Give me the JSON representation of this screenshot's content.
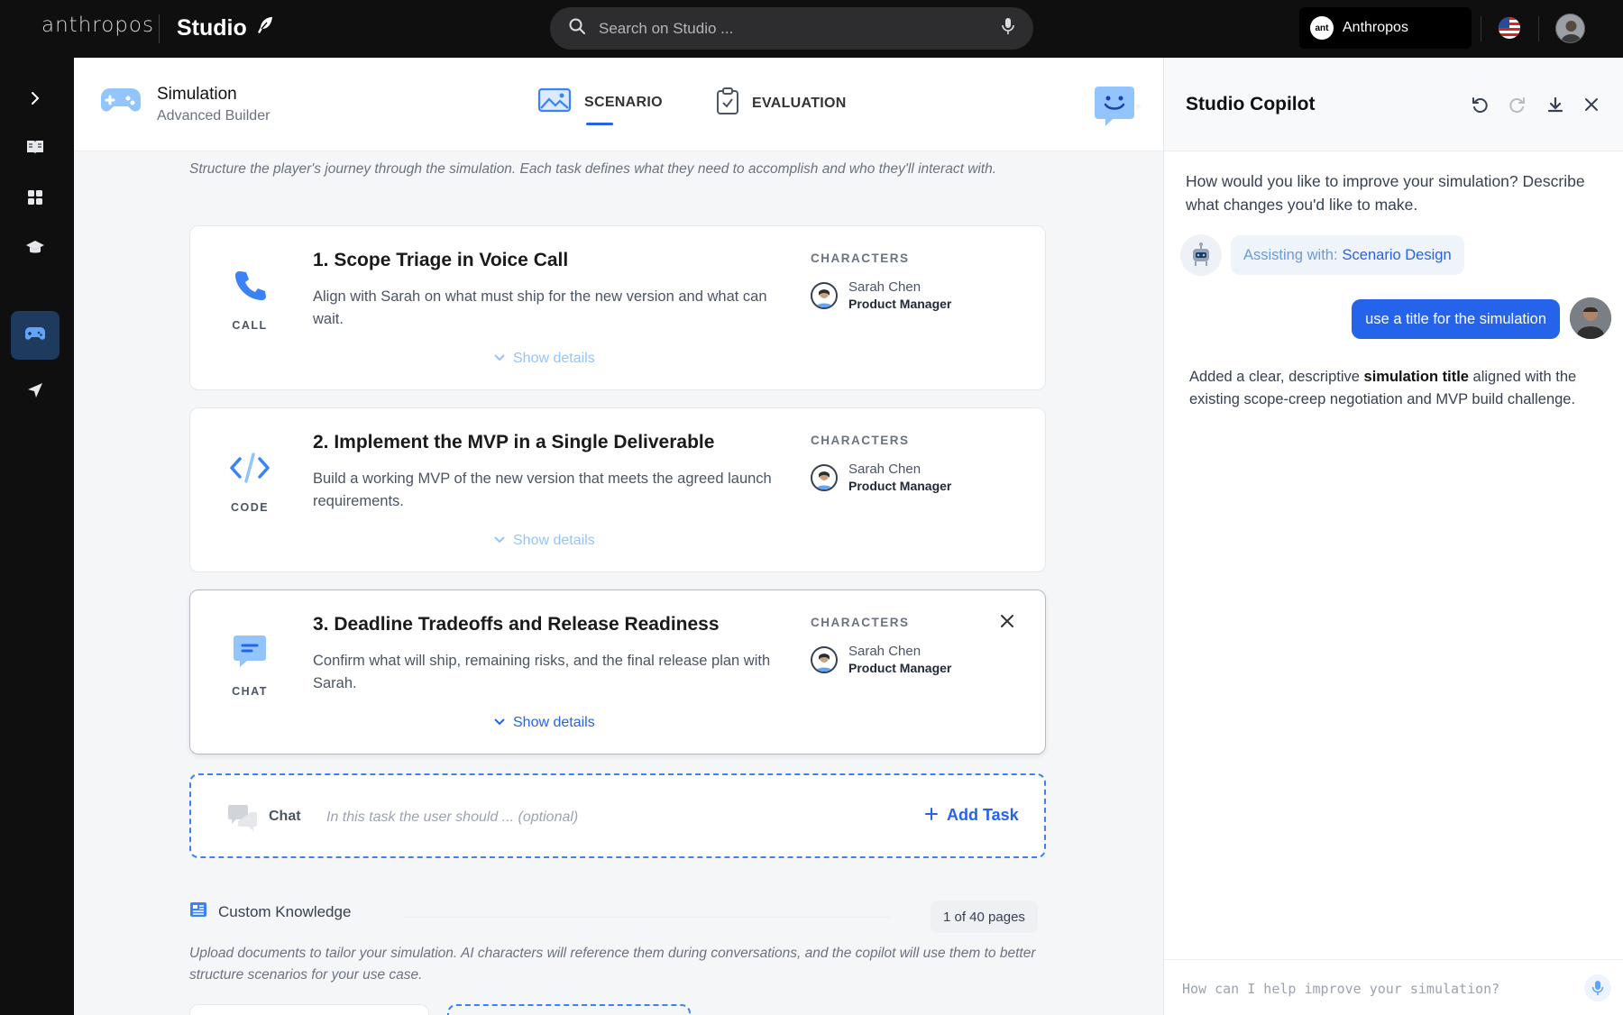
{
  "topbar": {
    "logo": "anthropos",
    "studio": "Studio",
    "search_placeholder": "Search on Studio ...",
    "org_name": "Anthropos",
    "org_badge": "ant"
  },
  "builder": {
    "title": "Simulation",
    "subtitle": "Advanced Builder",
    "tabs": [
      {
        "label": "SCENARIO",
        "active": true
      },
      {
        "label": "EVALUATION",
        "active": false
      }
    ]
  },
  "main": {
    "intro": "Structure the player's journey through the simulation. Each task defines what they need to accomplish and who they'll interact with.",
    "tasks": [
      {
        "type": "CALL",
        "title": "1. Scope Triage in Voice Call",
        "description": "Align with Sarah on what must ship for the new version and what can wait.",
        "show_details": "Show details",
        "characters_label": "CHARACTERS",
        "character_name": "Sarah Chen",
        "character_role": "Product Manager"
      },
      {
        "type": "CODE",
        "title": "2. Implement the MVP in a Single Deliverable",
        "description": "Build a working MVP of the new version that meets the agreed launch requirements.",
        "show_details": "Show details",
        "characters_label": "CHARACTERS",
        "character_name": "Sarah Chen",
        "character_role": "Product Manager"
      },
      {
        "type": "CHAT",
        "title": "3. Deadline Tradeoffs and Release Readiness",
        "description": "Confirm what will ship, remaining risks, and the final release plan with Sarah.",
        "show_details": "Show details",
        "characters_label": "CHARACTERS",
        "character_name": "Sarah Chen",
        "character_role": "Product Manager"
      }
    ],
    "add_task": {
      "type_label": "Chat",
      "placeholder": "In this task the user should ... (optional)",
      "button": "Add Task"
    },
    "custom_knowledge": {
      "title": "Custom Knowledge",
      "pages": "1 of 40 pages",
      "description": "Upload documents to tailor your simulation. AI characters will reference them during conversations, and the copilot will use them to better structure scenarios for your use case."
    }
  },
  "copilot": {
    "title": "Studio Copilot",
    "intro": "How would you like to improve your simulation? Describe what changes you'd like to make.",
    "assist_prefix": "Assisting with:",
    "assist_topic": "Scenario Design",
    "user_message": "use a title for the simulation",
    "reply_before": "Added a clear, descriptive ",
    "reply_bold": "simulation title",
    "reply_after": " aligned with the existing scope-creep negotiation and MVP build challenge.",
    "input_placeholder": "How can I help improve your simulation?"
  },
  "colors": {
    "accent": "#2563eb",
    "topbar": "#0f0f0f",
    "rail_active": "#1e3a5f"
  },
  "icons": [
    "search-icon",
    "mic-icon",
    "feather-icon",
    "chevron-right-icon",
    "book-icon",
    "grid-icon",
    "graduation-cap-icon",
    "gamepad-icon",
    "send-icon",
    "phone-icon",
    "code-icon",
    "chat-icon",
    "close-icon",
    "undo-icon",
    "redo-icon",
    "download-icon",
    "robot-icon",
    "plus-icon",
    "document-icon"
  ]
}
